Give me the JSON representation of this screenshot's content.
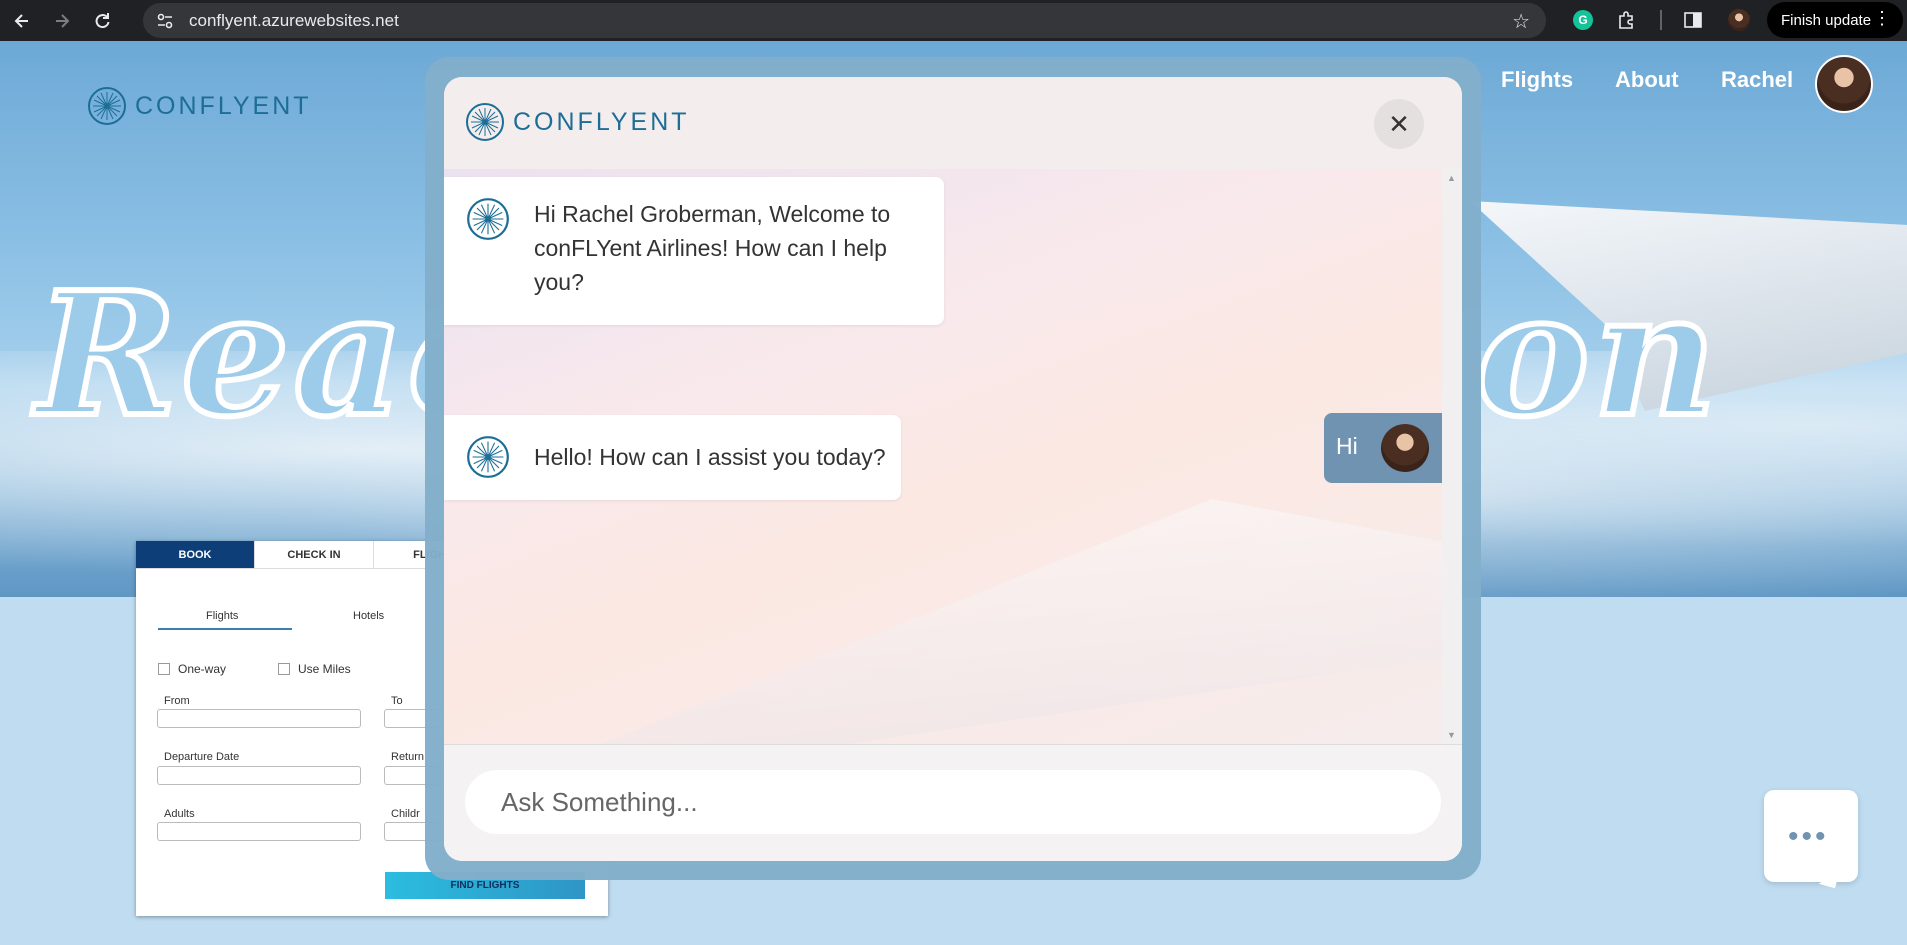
{
  "browser": {
    "url": "conflyent.azurewebsites.net",
    "finish_update_label": "Finish update"
  },
  "site": {
    "brand": "CONFLYENT",
    "nav": {
      "flights": "Flights",
      "about": "About",
      "user_name": "Rachel"
    },
    "hero_title_start": "Reac",
    "hero_title_end": "on"
  },
  "booking": {
    "tabs": [
      "BOOK",
      "CHECK IN",
      "FLIGHT"
    ],
    "subtabs": [
      "Flights",
      "Hotels"
    ],
    "options": [
      "One-way",
      "Use Miles"
    ],
    "fields": {
      "from": "From",
      "to": "To",
      "departure": "Departure Date",
      "return": "Return",
      "adults": "Adults",
      "children": "Childr"
    },
    "find_button": "FIND FLIGHTS"
  },
  "chat": {
    "brand": "CONFLYENT",
    "messages": [
      {
        "from": "bot",
        "text": "Hi Rachel Groberman, Welcome to conFLYent Airlines! How can I help you?"
      },
      {
        "from": "user",
        "text": "Hi"
      },
      {
        "from": "bot",
        "text": "Hello! How can I assist you today?"
      }
    ],
    "input_placeholder": "Ask Something..."
  },
  "colors": {
    "brand_blue": "#1d6e96",
    "book_tab": "#0d3e78",
    "user_bubble": "#6f93b1",
    "modal_frame": "#82aeca"
  }
}
